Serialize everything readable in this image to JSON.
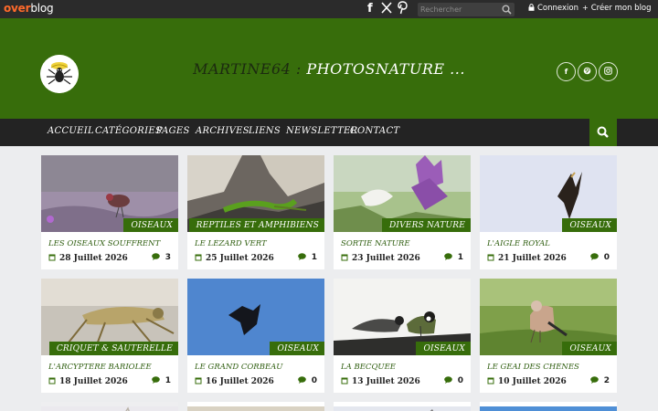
{
  "topbar": {
    "logo_over": "over",
    "logo_blog": "blog",
    "social": [
      "facebook-icon",
      "x-icon",
      "pinterest-icon"
    ],
    "search_placeholder": "Rechercher",
    "login_label": "Connexion",
    "create_label": "Créer mon blog"
  },
  "header": {
    "title_part1": "MARTINE64 :",
    "title_part2": "PHOTOSNATURE ...",
    "socials": [
      "f",
      "p",
      "ig"
    ],
    "bg_color": "#376d0b"
  },
  "nav": {
    "items": [
      "Accueil",
      "Catégories",
      "Pages",
      "Archives",
      "Liens",
      "Newsletter",
      "Contact"
    ]
  },
  "cards": [
    {
      "category": "OISEAUX",
      "title": "Les oiseaux souffrent",
      "date": "28 Juillet 2026",
      "comments": "3"
    },
    {
      "category": "REPTILES ET AMPHIBIENS",
      "title": "Le lézard vert",
      "date": "25 Juillet 2026",
      "comments": "1"
    },
    {
      "category": "DIVERS NATURE",
      "title": "Sortie nature",
      "date": "23 Juillet 2026",
      "comments": "1"
    },
    {
      "category": "OISEAUX",
      "title": "L'aigle royal",
      "date": "21 Juillet 2026",
      "comments": "0"
    },
    {
      "category": "CRIQUET & SAUTERELLE",
      "title": "L'arcyptère bariolée",
      "date": "18 Juillet 2026",
      "comments": "1"
    },
    {
      "category": "OISEAUX",
      "title": "Le grand corbeau",
      "date": "16 Juillet 2026",
      "comments": "0"
    },
    {
      "category": "OISEAUX",
      "title": "La becquée",
      "date": "13 Juillet 2026",
      "comments": "0"
    },
    {
      "category": "OISEAUX",
      "title": "Le geai des chênes",
      "date": "10 Juillet 2026",
      "comments": "2"
    }
  ],
  "colors": {
    "accent": "#376d0b",
    "nav_bg": "#232323",
    "topbar_bg": "#2b2b2b",
    "logo_orange": "#ff6a2b"
  }
}
